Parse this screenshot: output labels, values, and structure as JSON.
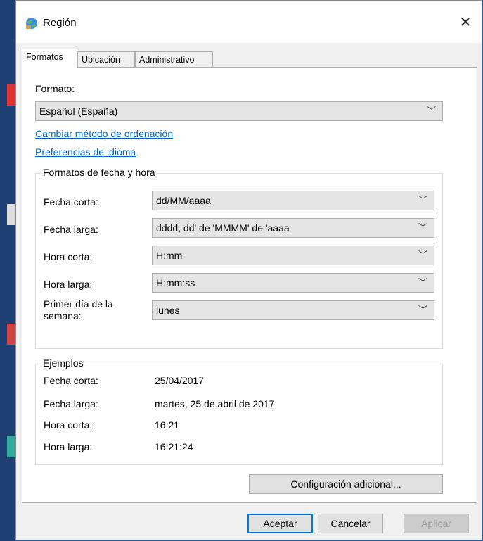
{
  "window": {
    "title": "Región",
    "close_glyph": "✕"
  },
  "tabs": [
    {
      "label": "Formatos",
      "active": true
    },
    {
      "label": "Ubicación",
      "active": false
    },
    {
      "label": "Administrativo",
      "active": false
    }
  ],
  "format": {
    "label": "Formato:",
    "value": "Español (España)",
    "link_sort": "Cambiar método de ordenación",
    "link_lang": "Preferencias de idioma"
  },
  "datetime": {
    "title": "Formatos de fecha y hora",
    "rows": [
      {
        "label": "Fecha corta:",
        "value": "dd/MM/aaaa"
      },
      {
        "label": "Fecha larga:",
        "value": "dddd, dd' de 'MMMM' de 'aaaa"
      },
      {
        "label": "Hora corta:",
        "value": "H:mm"
      },
      {
        "label": "Hora larga:",
        "value": "H:mm:ss"
      },
      {
        "label": "Primer día de la semana:",
        "value": "lunes"
      }
    ]
  },
  "examples": {
    "title": "Ejemplos",
    "rows": [
      {
        "label": "Fecha corta:",
        "value": "25/04/2017"
      },
      {
        "label": "Fecha larga:",
        "value": "martes, 25 de abril de 2017"
      },
      {
        "label": "Hora corta:",
        "value": "16:21"
      },
      {
        "label": "Hora larga:",
        "value": "16:21:24"
      }
    ]
  },
  "buttons": {
    "additional": "Configuración adicional...",
    "ok": "Aceptar",
    "cancel": "Cancelar",
    "apply": "Aplicar"
  },
  "icons": {
    "app": "globe-region-icon",
    "close": "close-icon",
    "dropdown": "chevron-down-icon"
  },
  "colors": {
    "link": "#0066cc",
    "focus_border": "#0078d7",
    "dialog_bg": "#f0f0f0"
  }
}
